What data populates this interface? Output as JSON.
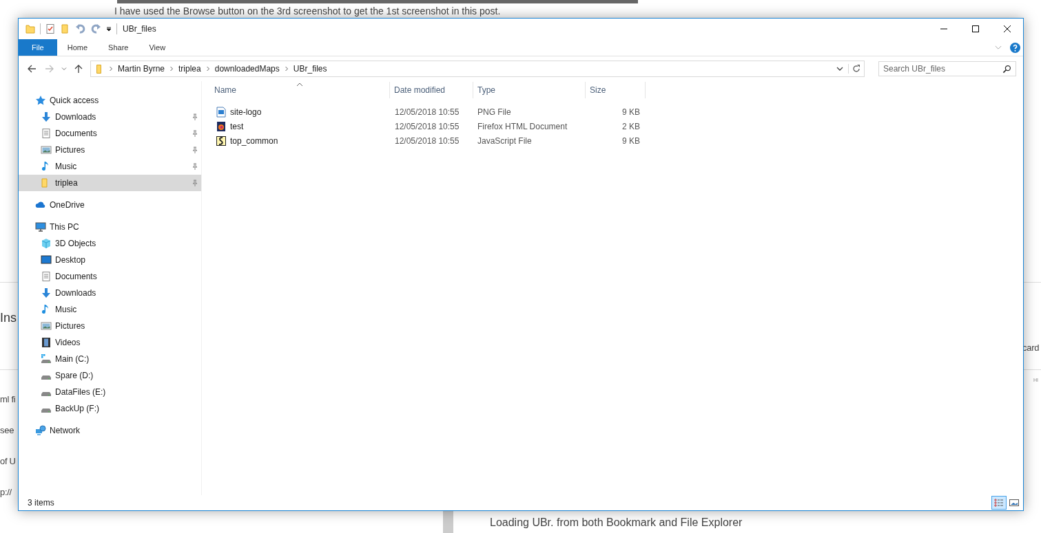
{
  "background_page": {
    "intro": "I have used the Browse button on the 3rd screenshot to get the 1st screenshot in this post.",
    "heading_fragment": "Ins",
    "fragments": [
      "ml fi",
      "see",
      "of U",
      "p://"
    ],
    "side_fragment": "card",
    "corner_fragment": "HI",
    "footer_line": "Loading UBr. from both Bookmark and File Explorer"
  },
  "window": {
    "title": "UBr_files"
  },
  "ribbon_tabs": [
    {
      "label": "File",
      "kind": "file"
    },
    {
      "label": "Home",
      "kind": "tab"
    },
    {
      "label": "Share",
      "kind": "tab"
    },
    {
      "label": "View",
      "kind": "tab"
    }
  ],
  "address": {
    "crumbs": [
      "Martin Byrne",
      "triplea",
      "downloadedMaps",
      "UBr_files"
    ]
  },
  "search": {
    "placeholder": "Search UBr_files"
  },
  "sidebar": {
    "items": [
      {
        "label": "Quick access",
        "kind": "star",
        "selected": false,
        "children": [
          {
            "label": "Downloads",
            "kind": "download",
            "pinned": true,
            "selected": false
          },
          {
            "label": "Documents",
            "kind": "document",
            "pinned": true,
            "selected": false
          },
          {
            "label": "Pictures",
            "kind": "picture",
            "pinned": true,
            "selected": false
          },
          {
            "label": "Music",
            "kind": "music",
            "pinned": true,
            "selected": false
          },
          {
            "label": "triplea",
            "kind": "folder",
            "pinned": true,
            "selected": true
          }
        ]
      },
      {
        "label": "OneDrive",
        "kind": "cloud",
        "selected": false
      },
      {
        "label": "This PC",
        "kind": "pc",
        "selected": false,
        "children": [
          {
            "label": "3D Objects",
            "kind": "cube",
            "pinned": false,
            "selected": false
          },
          {
            "label": "Desktop",
            "kind": "desktop",
            "pinned": false,
            "selected": false
          },
          {
            "label": "Documents",
            "kind": "document",
            "pinned": false,
            "selected": false
          },
          {
            "label": "Downloads",
            "kind": "download",
            "pinned": false,
            "selected": false
          },
          {
            "label": "Music",
            "kind": "music",
            "pinned": false,
            "selected": false
          },
          {
            "label": "Pictures",
            "kind": "picture",
            "pinned": false,
            "selected": false
          },
          {
            "label": "Videos",
            "kind": "video",
            "pinned": false,
            "selected": false
          },
          {
            "label": "Main (C:)",
            "kind": "system-drive",
            "pinned": false,
            "selected": false
          },
          {
            "label": "Spare (D:)",
            "kind": "drive",
            "pinned": false,
            "selected": false
          },
          {
            "label": "DataFiles (E:)",
            "kind": "drive",
            "pinned": false,
            "selected": false
          },
          {
            "label": "BackUp (F:)",
            "kind": "drive",
            "pinned": false,
            "selected": false
          }
        ]
      },
      {
        "label": "Network",
        "kind": "network",
        "selected": false
      }
    ]
  },
  "table": {
    "columns": [
      {
        "label": "Name",
        "sorted": true
      },
      {
        "label": "Date modified",
        "sorted": false
      },
      {
        "label": "Type",
        "sorted": false
      },
      {
        "label": "Size",
        "sorted": false
      }
    ],
    "rows": [
      {
        "name": "site-logo",
        "kind": "image",
        "date": "12/05/2018 10:55",
        "type": "PNG File",
        "size": "9 KB"
      },
      {
        "name": "test",
        "kind": "html",
        "date": "12/05/2018 10:55",
        "type": "Firefox HTML Document",
        "size": "2 KB"
      },
      {
        "name": "top_common",
        "kind": "script",
        "date": "12/05/2018 10:55",
        "type": "JavaScript File",
        "size": "9 KB"
      }
    ]
  },
  "status_bar": {
    "count": "3 items"
  },
  "view_buttons": [
    {
      "kind": "details",
      "selected": true
    },
    {
      "kind": "thumbnails",
      "selected": false
    }
  ]
}
